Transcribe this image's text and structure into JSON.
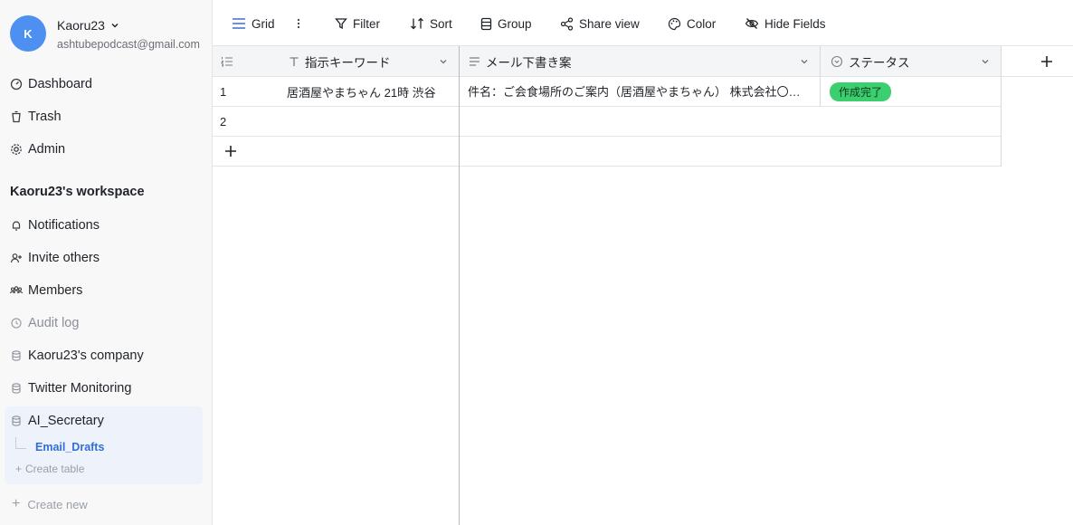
{
  "user": {
    "initial": "K",
    "name": "Kaoru23",
    "email": "ashtubepodcast@gmail.com"
  },
  "nav": {
    "dashboard": "Dashboard",
    "trash": "Trash",
    "admin": "Admin"
  },
  "workspace": {
    "title": "Kaoru23's workspace",
    "notifications": "Notifications",
    "invite": "Invite others",
    "members": "Members",
    "audit": "Audit log",
    "bases": [
      "Kaoru23's company",
      "Twitter Monitoring",
      "AI_Secretary"
    ],
    "active_table": "Email_Drafts",
    "create_table": "Create table",
    "create_new": "Create new"
  },
  "toolbar": {
    "grid": "Grid",
    "filter": "Filter",
    "sort": "Sort",
    "group": "Group",
    "share": "Share view",
    "color": "Color",
    "hide": "Hide Fields"
  },
  "table": {
    "columns": [
      "指示キーワード",
      "メール下書き案",
      "ステータス"
    ],
    "rows": [
      {
        "num": "1",
        "keyword": "居酒屋やまちゃん 21時 渋谷",
        "draft": "件名：ご会食場所のご案内（居酒屋やまちゃん） 株式会社〇〇 〇〇様",
        "status": "作成完了"
      },
      {
        "num": "2",
        "keyword": "",
        "draft": "",
        "status": ""
      }
    ]
  },
  "colors": {
    "accent": "#2f6fd8",
    "avatar": "#4e8ff2",
    "status_done": "#3ccf6f"
  }
}
